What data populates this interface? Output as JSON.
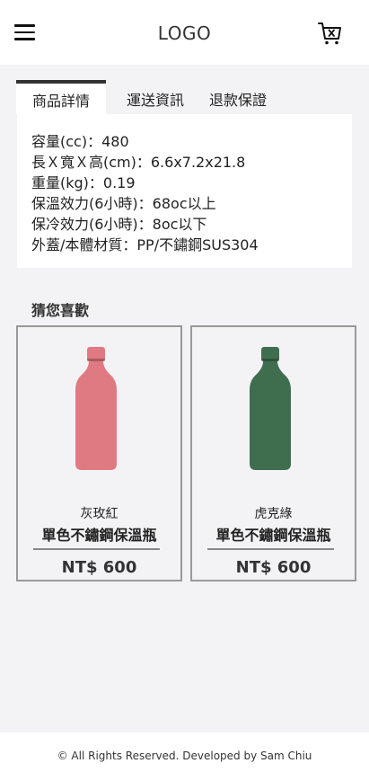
{
  "header": {
    "menu_icon": "hamburger-menu-icon",
    "logo": "LOGO",
    "cart_icon": "shopping-cart-icon"
  },
  "tabs": [
    {
      "label": "商品詳情",
      "active": true
    },
    {
      "label": "運送資訊",
      "active": false
    },
    {
      "label": "退款保證",
      "active": false
    }
  ],
  "details": [
    "容量(cc)：480",
    "長Ｘ寬Ｘ高(cm)：6.6x7.2x21.8",
    "重量(kg)：0.19",
    "保溫效力(6小時)：68oc以上",
    "保冷效力(6小時)：8oc以下",
    "外蓋/本體材質：PP/不鏽鋼SUS304"
  ],
  "recommend": {
    "title": "猜您喜歡",
    "items": [
      {
        "color": "灰玫紅",
        "name": "單色不鏽鋼保溫瓶",
        "price": "NT$ 600",
        "bottle_color": "#e07a82"
      },
      {
        "color": "虎克綠",
        "name": "單色不鏽鋼保溫瓶",
        "price": "NT$ 600",
        "bottle_color": "#3f6e4f"
      }
    ]
  },
  "footer": {
    "text": "© All Rights Reserved. Developed by Sam Chiu"
  }
}
